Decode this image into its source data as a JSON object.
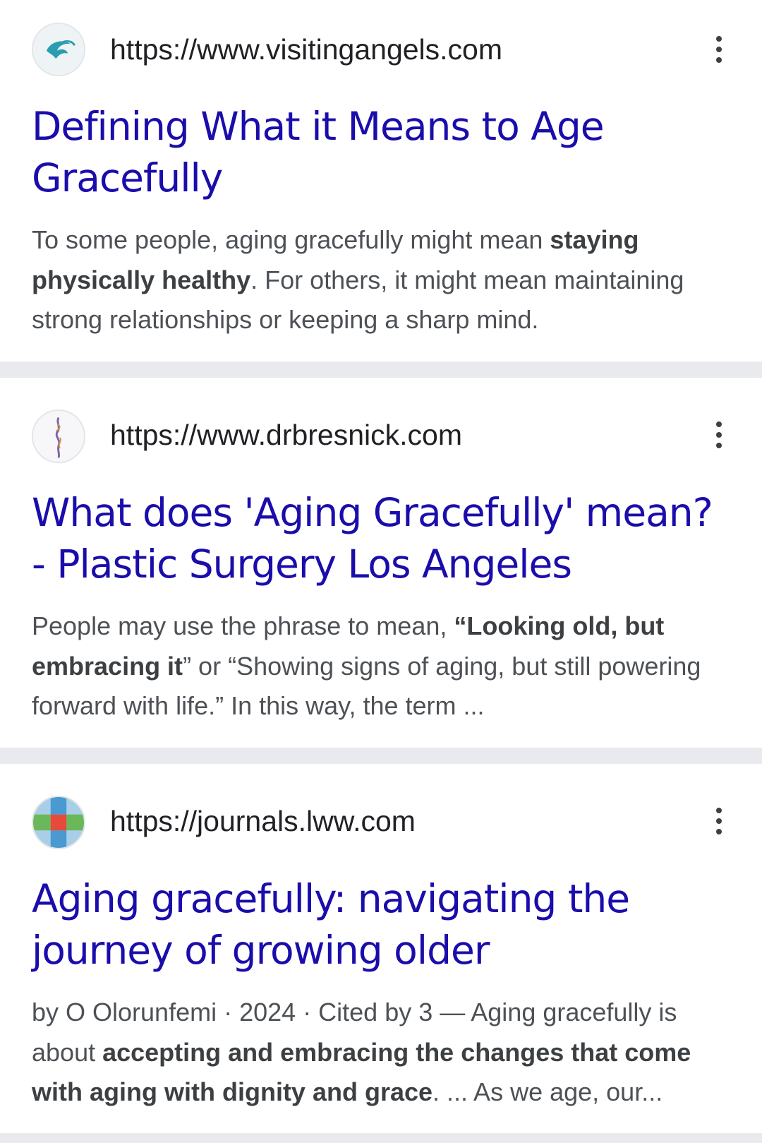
{
  "colors": {
    "link": "#1a0dab",
    "text": "#4d5156",
    "separator": "#e8eaed"
  },
  "results": [
    {
      "favicon_icon": "bird-swirl-icon",
      "url": "https://www.visitingangels.com",
      "title": "Defining What it Means to Age Gracefully",
      "snippet": [
        {
          "t": "To some people, aging gracefully might mean ",
          "b": false
        },
        {
          "t": "staying physically healthy",
          "b": true
        },
        {
          "t": ". For others, it might mean maintaining strong relationships or keeping a sharp mind.",
          "b": false
        }
      ]
    },
    {
      "favicon_icon": "figure-sketch-icon",
      "url": "https://www.drbresnick.com",
      "title": "What does 'Aging Gracefully' mean? - Plastic Surgery Los Angeles",
      "snippet": [
        {
          "t": "People may use the phrase to mean, ",
          "b": false
        },
        {
          "t": "“Looking old, but embracing it",
          "b": true
        },
        {
          "t": "” or “Showing signs of aging, but still powering forward with life.” In this way, the term ...",
          "b": false
        }
      ]
    },
    {
      "favicon_icon": "checker-grid-icon",
      "url": "https://journals.lww.com",
      "title": "Aging gracefully: navigating the journey of growing older",
      "snippet": [
        {
          "t": "by O Olorunfemi · 2024 · Cited by 3 — Aging gracefully is about ",
          "b": false
        },
        {
          "t": "accepting and embracing the changes that come with aging with dignity and grace",
          "b": true
        },
        {
          "t": ". ... As we age, our...",
          "b": false
        }
      ]
    }
  ]
}
